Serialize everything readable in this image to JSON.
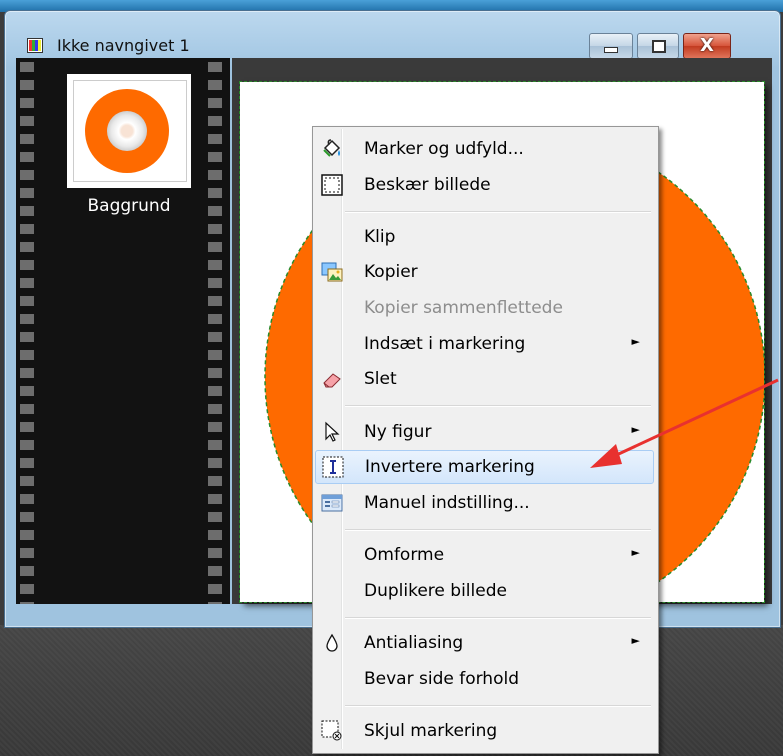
{
  "window": {
    "title": "Ikke navngivet 1",
    "controls": [
      "minimize",
      "maximize",
      "close"
    ],
    "close_glyph": "X"
  },
  "layers_panel": {
    "layers": [
      {
        "label": "Baggrund",
        "thumbnail": "orange-circle-with-white-rose"
      }
    ]
  },
  "canvas": {
    "fill_color": "#ffffff",
    "shape_color": "#fe6a00",
    "selection_outline_color": "#2a8a2a"
  },
  "context_menu": {
    "items": [
      {
        "label": "Marker og udfyld...",
        "icon": "fill-bucket-icon",
        "enabled": true,
        "submenu": false
      },
      {
        "label": "Beskær billede",
        "icon": "crop-icon",
        "enabled": true,
        "submenu": false
      },
      {
        "label": "Klip",
        "icon": "",
        "enabled": true,
        "submenu": false
      },
      {
        "label": "Kopier",
        "icon": "copy-image-icon",
        "enabled": true,
        "submenu": false
      },
      {
        "label": "Kopier sammenflettede",
        "icon": "",
        "enabled": false,
        "submenu": false
      },
      {
        "label": "Indsæt i markering",
        "icon": "",
        "enabled": true,
        "submenu": true
      },
      {
        "label": "Slet",
        "icon": "eraser-icon",
        "enabled": true,
        "submenu": false
      },
      {
        "label": "Ny figur",
        "icon": "cursor-icon",
        "enabled": true,
        "submenu": true
      },
      {
        "label": "Invertere markering",
        "icon": "invert-selection-icon",
        "enabled": true,
        "submenu": false,
        "highlighted": true
      },
      {
        "label": "Manuel indstilling...",
        "icon": "dialog-icon",
        "enabled": true,
        "submenu": false
      },
      {
        "label": "Omforme",
        "icon": "",
        "enabled": true,
        "submenu": true
      },
      {
        "label": "Duplikere billede",
        "icon": "",
        "enabled": true,
        "submenu": false
      },
      {
        "label": "Antialiasing",
        "icon": "drop-icon",
        "enabled": true,
        "submenu": true
      },
      {
        "label": "Bevar side forhold",
        "icon": "",
        "enabled": true,
        "submenu": false
      },
      {
        "label": "Skjul markering",
        "icon": "hide-selection-icon",
        "enabled": true,
        "submenu": false
      }
    ],
    "submenu_arrow": "►",
    "highlight_color": "#d3e6fb"
  },
  "annotation": {
    "arrow_color": "#e8312f"
  },
  "colors": {
    "titlebar": "#a9cbe6",
    "filmstrip": "#121212",
    "workspace": "#3c3c3c",
    "accent_orange": "#fe6a00"
  }
}
